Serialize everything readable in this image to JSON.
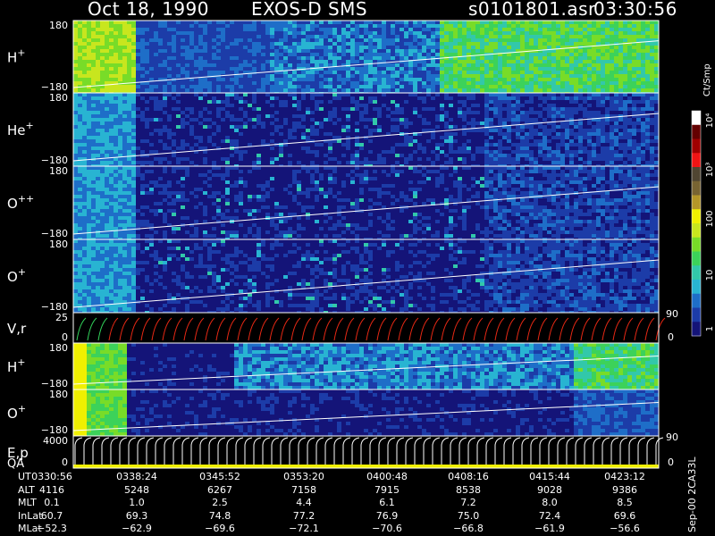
{
  "header": {
    "date": "Oct 18, 1990",
    "instrument": "EXOS-D SMS",
    "file": "s0101801.asr",
    "time": "03:30:56"
  },
  "colorbar": {
    "unit_label": "Ct/Smp",
    "ticks": [
      "1",
      "10",
      "100",
      "10³",
      "10⁴"
    ],
    "colors": [
      "#141478",
      "#1c3ca8",
      "#1e6ec8",
      "#28b4d2",
      "#32c8aa",
      "#3cd25a",
      "#78dc28",
      "#c8e61e",
      "#f0f000",
      "#b49628",
      "#786432",
      "#504632",
      "#f01414",
      "#a00000",
      "#640000",
      "#ffffff"
    ]
  },
  "panels": [
    {
      "label": "H",
      "sup": "+",
      "top": "180",
      "bottom": "−180",
      "right_label": "",
      "right_bottom": ""
    },
    {
      "label": "He",
      "sup": "+",
      "top": "180",
      "bottom": "−180",
      "right_label": "",
      "right_bottom": ""
    },
    {
      "label": "O",
      "sup": "++",
      "top": "180",
      "bottom": "−180",
      "right_label": "",
      "right_bottom": ""
    },
    {
      "label": "O",
      "sup": "+",
      "top": "180",
      "bottom": "−180",
      "right_label": "",
      "right_bottom": ""
    },
    {
      "label": "V,r",
      "sup": "",
      "top": "25",
      "bottom": "0",
      "right_label": "90",
      "right_bottom": "0"
    },
    {
      "label": "H",
      "sup": "+",
      "top": "180",
      "bottom": "−180",
      "right_label": "",
      "right_bottom": ""
    },
    {
      "label": "O",
      "sup": "+",
      "top": "180",
      "bottom": "−180",
      "right_label": "",
      "right_bottom": ""
    },
    {
      "label": "E,p",
      "sup": "",
      "top": "4000",
      "bottom": "0",
      "right_label": "90",
      "right_bottom": "0"
    }
  ],
  "qa_label": "QA",
  "footer": {
    "rows": [
      {
        "label": "UT",
        "values": [
          "0330:56",
          "0338:24",
          "0345:52",
          "0353:20",
          "0400:48",
          "0408:16",
          "0415:44",
          "0423:12"
        ]
      },
      {
        "label": "ALT",
        "values": [
          "4116",
          "5248",
          "6267",
          "7158",
          "7915",
          "8538",
          "9028",
          "9386"
        ]
      },
      {
        "label": "MLT",
        "values": [
          "0.1",
          "1.0",
          "2.5",
          "4.4",
          "6.1",
          "7.2",
          "8.0",
          "8.5"
        ]
      },
      {
        "label": "InLat",
        "values": [
          "60.7",
          "69.3",
          "74.8",
          "77.2",
          "76.9",
          "75.0",
          "72.4",
          "69.6"
        ]
      },
      {
        "label": "MLat",
        "values": [
          "−52.3",
          "−62.9",
          "−69.6",
          "−72.1",
          "−70.6",
          "−66.8",
          "−61.9",
          "−56.6"
        ]
      }
    ],
    "stamp": "Sep-00  2CA33L"
  },
  "chart_data": {
    "type": "heatmap",
    "title": "Oct 18, 1990   EXOS-D SMS",
    "x": [
      "0330:56",
      "0338:24",
      "0345:52",
      "0353:20",
      "0400:48",
      "0408:16",
      "0415:44",
      "0423:12"
    ],
    "color_scale": "log",
    "color_range": [
      1,
      10000
    ],
    "color_unit": "Ct/Smp",
    "panels": [
      {
        "name": "H+",
        "ylim": [
          -180,
          180
        ]
      },
      {
        "name": "He+",
        "ylim": [
          -180,
          180
        ]
      },
      {
        "name": "O++",
        "ylim": [
          -180,
          180
        ]
      },
      {
        "name": "O+",
        "ylim": [
          -180,
          180
        ]
      },
      {
        "name": "V,r",
        "ylim": [
          0,
          25
        ],
        "y2lim": [
          0,
          90
        ]
      },
      {
        "name": "H+",
        "ylim": [
          -180,
          180
        ]
      },
      {
        "name": "O+",
        "ylim": [
          -180,
          180
        ]
      },
      {
        "name": "E,p",
        "ylim": [
          0,
          4000
        ],
        "y2lim": [
          0,
          90
        ]
      }
    ]
  }
}
